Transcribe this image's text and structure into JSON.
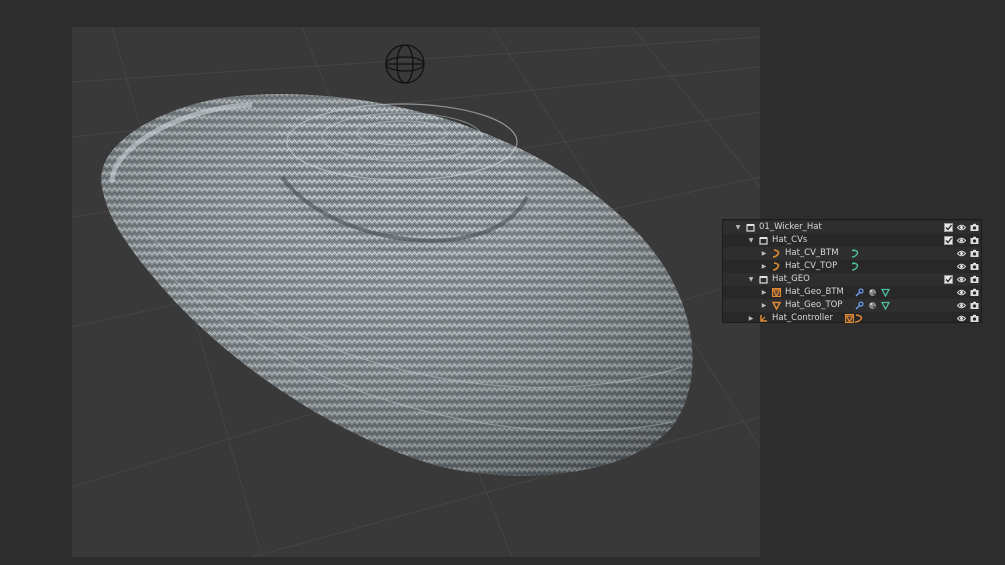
{
  "viewport": {
    "object_name": "wicker-hat-mesh",
    "background_color": "#393939",
    "grid_color": "#454545",
    "hat_color": "#8e969b"
  },
  "outliner": {
    "rows": [
      {
        "label": "01_Wicker_Hat",
        "type": "collection",
        "expanded": true,
        "checkbox": true
      },
      {
        "label": "Hat_CVs",
        "type": "collection",
        "expanded": true,
        "checkbox": true
      },
      {
        "label": "Hat_CV_BTM",
        "type": "curve",
        "expanded": false,
        "checkbox": false,
        "extras": [
          "curve-modifier-icon"
        ]
      },
      {
        "label": "Hat_CV_TOP",
        "type": "curve",
        "expanded": false,
        "checkbox": false,
        "extras": [
          "curve-modifier-icon"
        ]
      },
      {
        "label": "Hat_GEO",
        "type": "collection",
        "expanded": true,
        "checkbox": true
      },
      {
        "label": "Hat_Geo_BTM",
        "type": "mesh",
        "expanded": false,
        "checkbox": false,
        "extras": [
          "wrench-icon",
          "material-icon",
          "mesh-data-icon"
        ]
      },
      {
        "label": "Hat_Geo_TOP",
        "type": "mesh",
        "expanded": false,
        "checkbox": false,
        "extras": [
          "wrench-icon",
          "material-icon",
          "mesh-data-icon"
        ]
      },
      {
        "label": "Hat_Controller",
        "type": "empty",
        "expanded": false,
        "checkbox": false,
        "extras": [
          "child-objects-icon"
        ]
      }
    ]
  },
  "colors": {
    "accent_orange": "#e08a35",
    "data_green": "#4fc0a0",
    "wrench_blue": "#6e9ef2"
  }
}
